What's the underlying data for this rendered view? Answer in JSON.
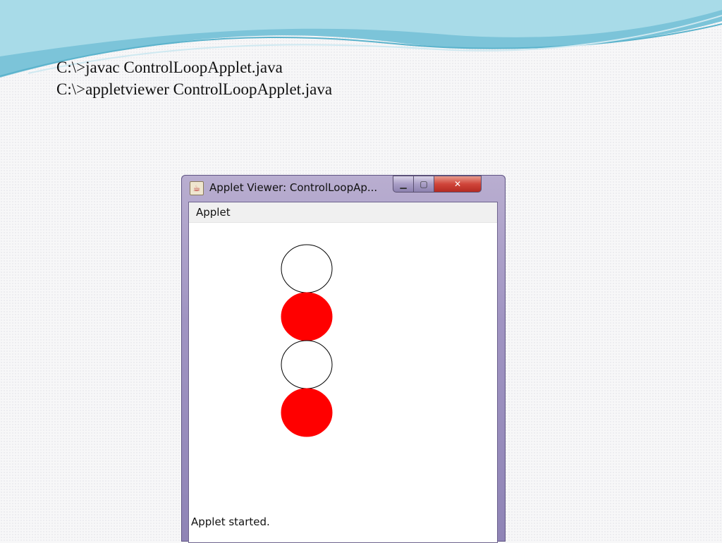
{
  "slide": {
    "commands": [
      "C:\\>javac ControlLoopApplet.java",
      "C:\\>appletviewer ControlLoopApplet.java"
    ]
  },
  "window": {
    "title": "Applet Viewer: ControlLoopAp...",
    "menu_label": "Applet",
    "status": "Applet started.",
    "controls": {
      "minimize": "▁",
      "maximize": "▢",
      "close": "✕"
    }
  },
  "colors": {
    "filled_circle": "#ff0000",
    "outline_circle": "#000000",
    "title_accent": "#a094c2",
    "close_button": "#d0453a"
  },
  "applet": {
    "circles": [
      {
        "fill": "none"
      },
      {
        "fill": "red"
      },
      {
        "fill": "none"
      },
      {
        "fill": "red"
      }
    ]
  }
}
